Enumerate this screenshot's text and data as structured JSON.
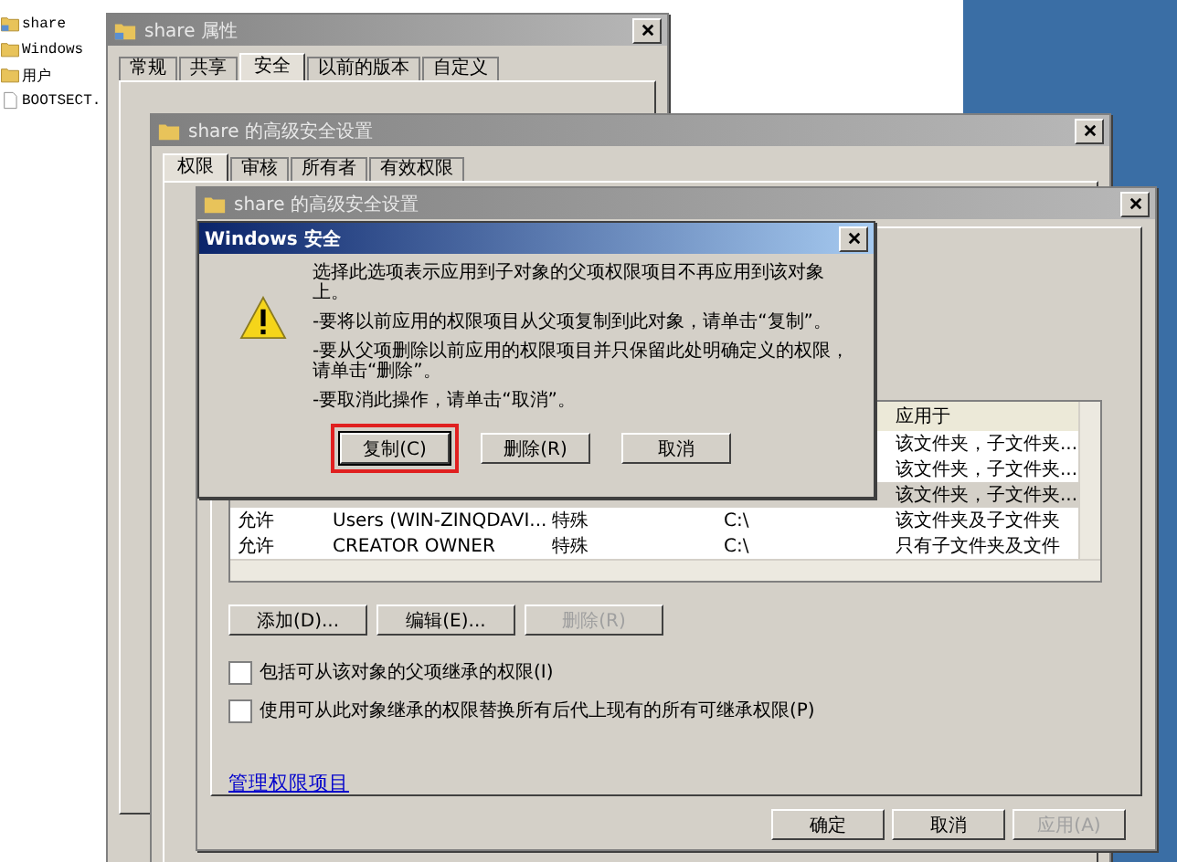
{
  "explorer": {
    "files": [
      {
        "name": "share",
        "kind": "shared-folder"
      },
      {
        "name": "Windows",
        "kind": "folder"
      },
      {
        "name": "用户",
        "kind": "folder"
      },
      {
        "name": "BOOTSECT.",
        "kind": "file"
      }
    ]
  },
  "properties_window": {
    "title": "share 属性",
    "tabs": [
      {
        "label": "常规",
        "selected": false
      },
      {
        "label": "共享",
        "selected": false
      },
      {
        "label": "安全",
        "selected": true
      },
      {
        "label": "以前的版本",
        "selected": false
      },
      {
        "label": "自定义",
        "selected": false
      }
    ]
  },
  "advanced_window_back": {
    "title": "share 的高级安全设置",
    "tabs": [
      {
        "label": "权限",
        "selected": true
      },
      {
        "label": "审核",
        "selected": false
      },
      {
        "label": "所有者",
        "selected": false
      },
      {
        "label": "有效权限",
        "selected": false
      }
    ]
  },
  "advanced_window": {
    "title": "share 的高级安全设置",
    "table": {
      "visible_column": "应用于",
      "rows": [
        {
          "applies_to": "该文件夹，子文件夹...",
          "selected": false
        },
        {
          "applies_to": "该文件夹，子文件夹...",
          "selected": false
        },
        {
          "applies_to": "该文件夹，子文件夹...",
          "selected": true
        },
        {
          "type": "允许",
          "name": "Users (WIN-ZINQDAVI...",
          "permission": "特殊",
          "inherited_from": "C:\\",
          "applies_to": "该文件夹及子文件夹",
          "selected": false
        },
        {
          "type": "允许",
          "name": "CREATOR OWNER",
          "permission": "特殊",
          "inherited_from": "C:\\",
          "applies_to": "只有子文件夹及文件",
          "selected": false
        }
      ]
    },
    "buttons": [
      {
        "label": "添加(D)...",
        "disabled": false
      },
      {
        "label": "编辑(E)...",
        "disabled": false
      },
      {
        "label": "删除(R)",
        "disabled": true
      }
    ],
    "checkboxes": [
      {
        "label": "包括可从该对象的父项继承的权限(I)",
        "checked": false
      },
      {
        "label": "使用可从此对象继承的权限替换所有后代上现有的所有可继承权限(P)",
        "checked": false
      }
    ],
    "link": "管理权限项目",
    "footer_buttons": [
      {
        "label": "确定",
        "disabled": false
      },
      {
        "label": "取消",
        "disabled": false
      },
      {
        "label": "应用(A)",
        "disabled": true
      }
    ]
  },
  "security_dialog": {
    "title": "Windows 安全",
    "paragraphs": [
      "选择此选项表示应用到子对象的父项权限项目不再应用到该对象上。",
      "-要将以前应用的权限项目从父项复制到此对象，请单击“复制”。",
      "-要从父项删除以前应用的权限项目并只保留此处明确定义的权限，请单击“删除”。",
      "-要取消此操作，请单击“取消”。"
    ],
    "buttons": [
      {
        "label": "复制(C)",
        "highlighted": true
      },
      {
        "label": "删除(R)",
        "highlighted": false
      },
      {
        "label": "取消",
        "highlighted": false
      }
    ]
  }
}
